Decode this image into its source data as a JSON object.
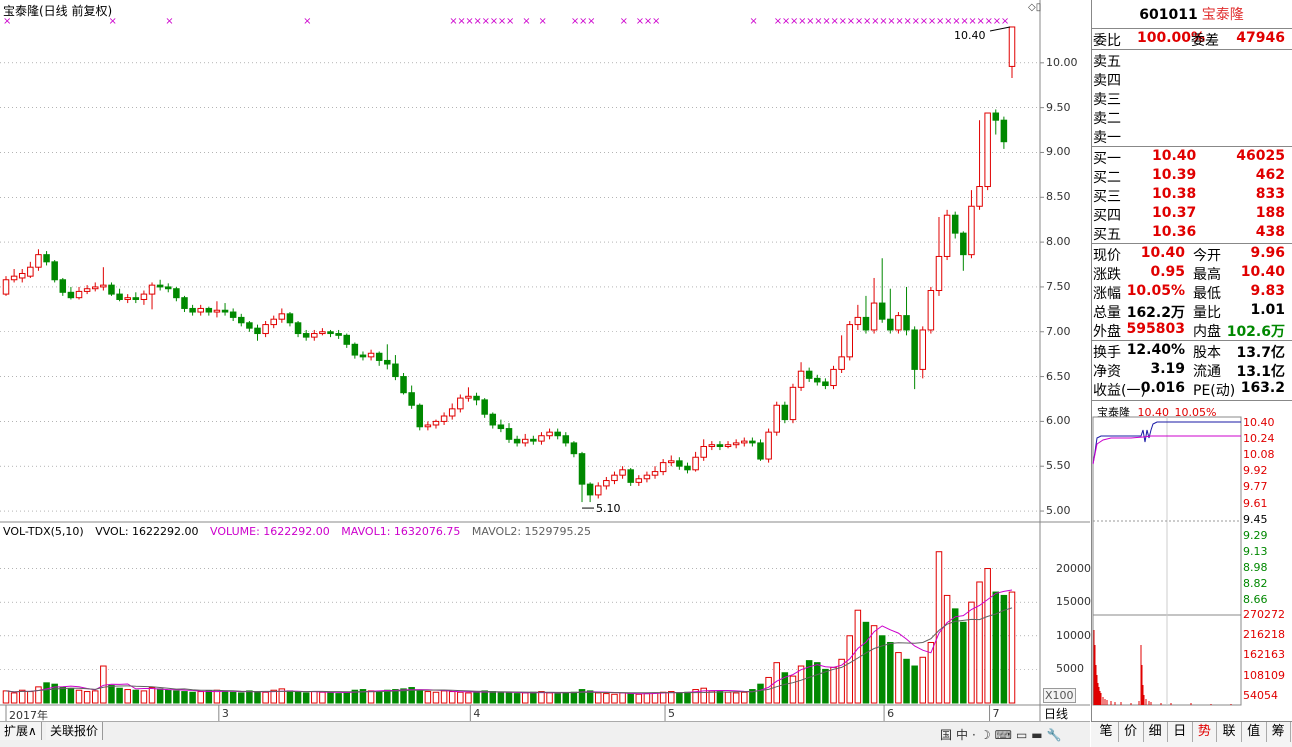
{
  "chart_header": {
    "title": "宝泰隆(日线 前复权)",
    "high_marker": "10.40",
    "low_marker": "5.10"
  },
  "price_axis": [
    "10.00",
    "9.50",
    "9.00",
    "8.50",
    "8.00",
    "7.50",
    "7.00",
    "6.50",
    "6.00",
    "5.50",
    "5.00"
  ],
  "volume_axis": [
    "20000",
    "15000",
    "10000",
    "5000"
  ],
  "volume_header": {
    "name": "VOL-TDX(5,10)",
    "vvol": "VVOL: 1622292.00",
    "volume": "VOLUME: 1622292.00",
    "mavol1": "MAVOL1: 1632076.75",
    "mavol2": "MAVOL2: 1529795.25"
  },
  "date_axis": [
    "2017年",
    "3",
    "4",
    "5",
    "6",
    "7"
  ],
  "x100_label": "X100",
  "period_label": "日线",
  "bottom_tabs_left": [
    "扩展∧",
    "关联报价"
  ],
  "tray_icons": [
    "国",
    "中",
    "·",
    "☽",
    "⌨",
    "▭",
    "▬",
    "🔧"
  ],
  "chart_data": {
    "type": "candlestick",
    "title": "宝泰隆(日线 前复权)",
    "ylim": [
      4.9,
      10.5
    ],
    "candles": [
      [
        7.42,
        7.58,
        7.4,
        7.62
      ],
      [
        7.58,
        7.62,
        7.55,
        7.7
      ],
      [
        7.6,
        7.65,
        7.55,
        7.7
      ],
      [
        7.62,
        7.72,
        7.6,
        7.78
      ],
      [
        7.72,
        7.86,
        7.68,
        7.92
      ],
      [
        7.86,
        7.78,
        7.74,
        7.9
      ],
      [
        7.78,
        7.58,
        7.55,
        7.8
      ],
      [
        7.58,
        7.44,
        7.4,
        7.6
      ],
      [
        7.44,
        7.38,
        7.36,
        7.5
      ],
      [
        7.38,
        7.45,
        7.36,
        7.5
      ],
      [
        7.45,
        7.48,
        7.42,
        7.52
      ],
      [
        7.48,
        7.5,
        7.45,
        7.55
      ],
      [
        7.5,
        7.52,
        7.46,
        7.72
      ],
      [
        7.52,
        7.42,
        7.4,
        7.55
      ],
      [
        7.42,
        7.36,
        7.34,
        7.48
      ],
      [
        7.36,
        7.38,
        7.32,
        7.42
      ],
      [
        7.38,
        7.36,
        7.32,
        7.44
      ],
      [
        7.36,
        7.42,
        7.3,
        7.46
      ],
      [
        7.42,
        7.52,
        7.25,
        7.55
      ],
      [
        7.52,
        7.5,
        7.46,
        7.58
      ],
      [
        7.5,
        7.48,
        7.44,
        7.54
      ],
      [
        7.48,
        7.38,
        7.34,
        7.5
      ],
      [
        7.38,
        7.26,
        7.22,
        7.4
      ],
      [
        7.26,
        7.22,
        7.18,
        7.3
      ],
      [
        7.22,
        7.26,
        7.18,
        7.3
      ],
      [
        7.26,
        7.22,
        7.18,
        7.28
      ],
      [
        7.22,
        7.24,
        7.16,
        7.34
      ],
      [
        7.24,
        7.22,
        7.18,
        7.32
      ],
      [
        7.22,
        7.16,
        7.12,
        7.26
      ],
      [
        7.16,
        7.1,
        7.06,
        7.2
      ],
      [
        7.1,
        7.04,
        7.0,
        7.12
      ],
      [
        7.04,
        6.98,
        6.9,
        7.08
      ],
      [
        6.98,
        7.08,
        6.94,
        7.12
      ],
      [
        7.08,
        7.14,
        7.04,
        7.18
      ],
      [
        7.14,
        7.2,
        7.1,
        7.26
      ],
      [
        7.2,
        7.1,
        7.06,
        7.22
      ],
      [
        7.1,
        6.98,
        6.94,
        7.12
      ],
      [
        6.98,
        6.94,
        6.9,
        7.02
      ],
      [
        6.94,
        6.98,
        6.9,
        7.02
      ],
      [
        6.98,
        7.0,
        6.96,
        7.04
      ],
      [
        7.0,
        6.98,
        6.94,
        7.02
      ],
      [
        6.98,
        6.96,
        6.92,
        7.02
      ],
      [
        6.96,
        6.86,
        6.82,
        6.98
      ],
      [
        6.86,
        6.74,
        6.7,
        6.88
      ],
      [
        6.74,
        6.72,
        6.68,
        6.78
      ],
      [
        6.72,
        6.76,
        6.68,
        6.8
      ],
      [
        6.76,
        6.68,
        6.62,
        6.78
      ],
      [
        6.68,
        6.64,
        6.58,
        6.86
      ],
      [
        6.64,
        6.5,
        6.46,
        6.74
      ],
      [
        6.5,
        6.32,
        6.3,
        6.54
      ],
      [
        6.32,
        6.18,
        6.14,
        6.4
      ],
      [
        6.18,
        5.94,
        5.9,
        6.2
      ],
      [
        5.94,
        5.96,
        5.9,
        6.0
      ],
      [
        5.96,
        6.0,
        5.92,
        6.02
      ],
      [
        6.0,
        6.06,
        5.96,
        6.1
      ],
      [
        6.06,
        6.14,
        6.02,
        6.2
      ],
      [
        6.14,
        6.26,
        6.1,
        6.3
      ],
      [
        6.26,
        6.28,
        6.22,
        6.38
      ],
      [
        6.28,
        6.24,
        6.18,
        6.32
      ],
      [
        6.24,
        6.08,
        6.04,
        6.26
      ],
      [
        6.08,
        5.96,
        5.92,
        6.1
      ],
      [
        5.96,
        5.92,
        5.88,
        6.02
      ],
      [
        5.92,
        5.8,
        5.76,
        5.98
      ],
      [
        5.8,
        5.76,
        5.72,
        5.84
      ],
      [
        5.76,
        5.8,
        5.72,
        5.86
      ],
      [
        5.8,
        5.78,
        5.74,
        5.84
      ],
      [
        5.78,
        5.84,
        5.74,
        5.88
      ],
      [
        5.84,
        5.88,
        5.8,
        5.92
      ],
      [
        5.88,
        5.84,
        5.8,
        5.92
      ],
      [
        5.84,
        5.76,
        5.72,
        5.88
      ],
      [
        5.76,
        5.64,
        5.6,
        5.78
      ],
      [
        5.64,
        5.3,
        5.1,
        5.66
      ],
      [
        5.3,
        5.18,
        5.1,
        5.32
      ],
      [
        5.18,
        5.28,
        5.14,
        5.32
      ],
      [
        5.28,
        5.34,
        5.24,
        5.38
      ],
      [
        5.34,
        5.4,
        5.3,
        5.44
      ],
      [
        5.4,
        5.46,
        5.36,
        5.5
      ],
      [
        5.46,
        5.32,
        5.28,
        5.48
      ],
      [
        5.32,
        5.36,
        5.28,
        5.4
      ],
      [
        5.36,
        5.4,
        5.32,
        5.44
      ],
      [
        5.4,
        5.44,
        5.36,
        5.5
      ],
      [
        5.44,
        5.54,
        5.4,
        5.58
      ],
      [
        5.54,
        5.56,
        5.5,
        5.62
      ],
      [
        5.56,
        5.5,
        5.46,
        5.6
      ],
      [
        5.5,
        5.46,
        5.42,
        5.54
      ],
      [
        5.46,
        5.6,
        5.44,
        5.66
      ],
      [
        5.6,
        5.72,
        5.56,
        5.8
      ],
      [
        5.72,
        5.74,
        5.68,
        5.78
      ],
      [
        5.74,
        5.72,
        5.68,
        5.78
      ],
      [
        5.72,
        5.74,
        5.7,
        5.78
      ],
      [
        5.74,
        5.76,
        5.7,
        5.8
      ],
      [
        5.76,
        5.78,
        5.72,
        5.82
      ],
      [
        5.78,
        5.76,
        5.72,
        5.82
      ],
      [
        5.76,
        5.58,
        5.56,
        5.8
      ],
      [
        5.58,
        5.88,
        5.54,
        5.92
      ],
      [
        5.88,
        6.18,
        5.84,
        6.22
      ],
      [
        6.18,
        6.02,
        5.98,
        6.22
      ],
      [
        6.02,
        6.38,
        5.98,
        6.42
      ],
      [
        6.38,
        6.56,
        6.34,
        6.66
      ],
      [
        6.56,
        6.48,
        6.44,
        6.6
      ],
      [
        6.48,
        6.44,
        6.4,
        6.52
      ],
      [
        6.44,
        6.4,
        6.36,
        6.48
      ],
      [
        6.4,
        6.58,
        6.36,
        6.62
      ],
      [
        6.58,
        6.72,
        6.54,
        6.96
      ],
      [
        6.72,
        7.08,
        6.68,
        7.12
      ],
      [
        7.08,
        7.16,
        7.02,
        7.3
      ],
      [
        7.16,
        7.02,
        6.98,
        7.4
      ],
      [
        7.02,
        7.32,
        6.98,
        7.6
      ],
      [
        7.32,
        7.14,
        7.1,
        7.82
      ],
      [
        7.14,
        7.02,
        6.98,
        7.48
      ],
      [
        7.02,
        7.18,
        6.98,
        7.22
      ],
      [
        7.18,
        7.02,
        6.96,
        7.5
      ],
      [
        7.02,
        6.58,
        6.36,
        7.06
      ],
      [
        6.58,
        7.02,
        6.48,
        7.06
      ],
      [
        7.02,
        7.46,
        6.98,
        7.5
      ],
      [
        7.46,
        7.84,
        7.4,
        8.28
      ],
      [
        7.84,
        8.3,
        7.8,
        8.36
      ],
      [
        8.3,
        8.1,
        8.04,
        8.34
      ],
      [
        8.1,
        7.86,
        7.68,
        8.12
      ],
      [
        7.86,
        8.4,
        7.82,
        8.58
      ],
      [
        8.4,
        8.62,
        8.36,
        9.36
      ],
      [
        8.62,
        9.44,
        8.58,
        9.44
      ],
      [
        9.44,
        9.36,
        9.2,
        9.48
      ],
      [
        9.36,
        9.12,
        9.04,
        9.4
      ],
      [
        9.96,
        10.4,
        9.83,
        10.4
      ]
    ],
    "volumes": [
      1800,
      1500,
      1900,
      1700,
      2400,
      3000,
      2800,
      2300,
      2100,
      1900,
      1700,
      1800,
      5500,
      2600,
      2200,
      2000,
      1900,
      1800,
      2300,
      2100,
      1900,
      1800,
      1700,
      1600,
      1700,
      1800,
      1900,
      1700,
      1600,
      1500,
      1800,
      1700,
      1600,
      1900,
      2100,
      1800,
      1600,
      1500,
      1700,
      1600,
      1500,
      1400,
      1600,
      1900,
      2000,
      1800,
      1700,
      1900,
      2000,
      2100,
      2300,
      1900,
      1700,
      1600,
      1800,
      1700,
      1600,
      1500,
      1600,
      1800,
      1700,
      1600,
      1500,
      1400,
      1500,
      1600,
      1700,
      1500,
      1400,
      1500,
      1600,
      2000,
      1800,
      1500,
      1400,
      1300,
      1500,
      1400,
      1300,
      1400,
      1500,
      1600,
      1700,
      1500,
      1600,
      2000,
      2200,
      1800,
      1700,
      1600,
      1500,
      1600,
      2000,
      2800,
      3800,
      6000,
      4500,
      4000,
      5500,
      6300,
      6000,
      5000,
      5300,
      6500,
      10000,
      13800,
      12000,
      11500,
      10000,
      9000,
      7500,
      6500,
      5500,
      6800,
      9000,
      22500,
      16000,
      14000,
      12000,
      15000,
      18000,
      20000,
      16500,
      16000,
      16500
    ],
    "mavol1": [
      1800,
      1650,
      1730,
      1720,
      1860,
      2100,
      2380,
      2420,
      2520,
      2420,
      2160,
      1960,
      2640,
      2800,
      2760,
      2820,
      2100,
      2160,
      2160,
      2060,
      2000,
      1960,
      1920,
      1880,
      1740,
      1720,
      1700,
      1740,
      1740,
      1700,
      1700,
      1660,
      1680,
      1700,
      1740,
      1780,
      1740,
      1700,
      1700,
      1640,
      1600,
      1580,
      1560,
      1620,
      1680,
      1740,
      1800,
      1860,
      1880,
      1940,
      1980,
      2000,
      1960,
      1920,
      1860,
      1740,
      1680,
      1660,
      1640,
      1640,
      1640,
      1640,
      1600,
      1560,
      1520,
      1520,
      1540,
      1540,
      1500,
      1540,
      1540,
      1640,
      1660,
      1640,
      1620,
      1560,
      1500,
      1420,
      1380,
      1380,
      1420,
      1480,
      1540,
      1540,
      1580,
      1680,
      1800,
      1840,
      1860,
      1860,
      1800,
      1720,
      1680,
      1900,
      2340,
      3240,
      3820,
      4220,
      4960,
      5380,
      5700,
      5400,
      5300,
      5620,
      6560,
      8120,
      9060,
      10600,
      11460,
      10880,
      10400,
      9500,
      8480,
      7860,
      7460,
      10400,
      11960,
      12820,
      13000,
      13900,
      14500,
      15400,
      16300,
      16600,
      16800
    ],
    "mavol2": [
      1800,
      1650,
      1730,
      1720,
      1860,
      1950,
      2080,
      2160,
      2220,
      2190,
      2130,
      2020,
      2330,
      2490,
      2530,
      2550,
      2490,
      2460,
      2430,
      2310,
      2190,
      2060,
      2090,
      1980,
      1910,
      1900,
      1870,
      1840,
      1810,
      1760,
      1720,
      1710,
      1720,
      1720,
      1720,
      1720,
      1700,
      1700,
      1720,
      1720,
      1700,
      1690,
      1680,
      1660,
      1670,
      1680,
      1690,
      1730,
      1790,
      1830,
      1870,
      1900,
      1910,
      1930,
      1940,
      1890,
      1840,
      1800,
      1760,
      1720,
      1680,
      1660,
      1650,
      1630,
      1620,
      1600,
      1590,
      1590,
      1580,
      1570,
      1570,
      1580,
      1590,
      1580,
      1560,
      1540,
      1540,
      1530,
      1520,
      1530,
      1540,
      1550,
      1550,
      1540,
      1540,
      1540,
      1560,
      1600,
      1630,
      1640,
      1660,
      1680,
      1700,
      1840,
      2020,
      2420,
      2770,
      3020,
      3390,
      3810,
      4220,
      4620,
      5010,
      5290,
      5960,
      6700,
      7450,
      8100,
      8490,
      8850,
      8970,
      8930,
      8890,
      9000,
      9570,
      10800,
      11720,
      12140,
      12280,
      12430,
      12400,
      12880,
      13230,
      13790,
      14140
    ]
  },
  "quote": {
    "code": "601011",
    "name": "宝泰隆",
    "weibi_label": "委比",
    "weibi_value": "100.00%",
    "weicha_label": "委差",
    "weicha_value": "47946",
    "sell": [
      {
        "label": "卖五",
        "price": "",
        "vol": ""
      },
      {
        "label": "卖四",
        "price": "",
        "vol": ""
      },
      {
        "label": "卖三",
        "price": "",
        "vol": ""
      },
      {
        "label": "卖二",
        "price": "",
        "vol": ""
      },
      {
        "label": "卖一",
        "price": "",
        "vol": ""
      }
    ],
    "buy": [
      {
        "label": "买一",
        "price": "10.40",
        "vol": "46025"
      },
      {
        "label": "买二",
        "price": "10.39",
        "vol": "462"
      },
      {
        "label": "买三",
        "price": "10.38",
        "vol": "833"
      },
      {
        "label": "买四",
        "price": "10.37",
        "vol": "188"
      },
      {
        "label": "买五",
        "price": "10.36",
        "vol": "438"
      }
    ],
    "stats": [
      {
        "l1": "现价",
        "v1": "10.40",
        "c1": "red",
        "l2": "今开",
        "v2": "9.96",
        "c2": "red"
      },
      {
        "l1": "涨跌",
        "v1": "0.95",
        "c1": "red",
        "l2": "最高",
        "v2": "10.40",
        "c2": "red"
      },
      {
        "l1": "涨幅",
        "v1": "10.05%",
        "c1": "red",
        "l2": "最低",
        "v2": "9.83",
        "c2": "red"
      },
      {
        "l1": "总量",
        "v1": "162.2万",
        "c1": "blk",
        "l2": "量比",
        "v2": "1.01",
        "c2": "blk"
      },
      {
        "l1": "外盘",
        "v1": "595803",
        "c1": "red",
        "l2": "内盘",
        "v2": "102.6万",
        "c2": "grn"
      }
    ],
    "fund": [
      {
        "l1": "换手",
        "v1": "12.40%",
        "l2": "股本",
        "v2": "13.7亿"
      },
      {
        "l1": "净资",
        "v1": "3.19",
        "l2": "流通",
        "v2": "13.1亿"
      },
      {
        "l1": "收益(一)",
        "v1": "0.016",
        "l2": "PE(动)",
        "v2": "163.2"
      }
    ]
  },
  "mini_chart": {
    "title_name": "宝泰隆",
    "title_price": "10.40",
    "title_pct": "10.05%",
    "price_ticks": [
      "10.40",
      "10.24",
      "10.08",
      "9.92",
      "9.77",
      "9.61",
      "9.45",
      "9.29",
      "9.13",
      "8.98",
      "8.82",
      "8.66"
    ],
    "vol_ticks": [
      "270272",
      "216218",
      "162163",
      "108109",
      "54054"
    ]
  },
  "bottom_tabs_right": [
    "笔",
    "价",
    "细",
    "日",
    "势",
    "联",
    "值",
    "筹"
  ],
  "colors": {
    "up": "#e00000",
    "down": "#008800",
    "ma1": "#cc00cc",
    "ma2": "#606060",
    "grid": "#888888"
  }
}
